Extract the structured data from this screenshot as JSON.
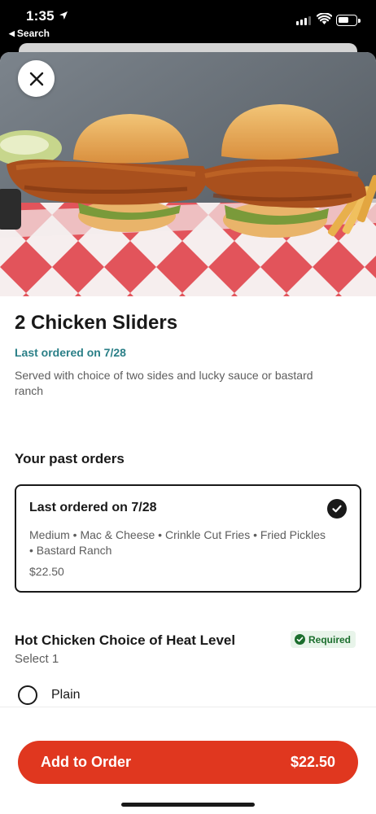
{
  "status_bar": {
    "time": "1:35",
    "back_label": "Search"
  },
  "item": {
    "name": "2 Chicken Sliders",
    "last_ordered": "Last ordered on 7/28",
    "description": "Served with choice of two sides and lucky sauce or bastard ranch"
  },
  "past_orders": {
    "heading": "Your past orders",
    "card": {
      "title": "Last ordered on 7/28",
      "items": "Medium • Mac & Cheese • Crinkle Cut Fries • Fried Pickles • Bastard Ranch",
      "price": "$22.50",
      "selected": true
    }
  },
  "option_group": {
    "title": "Hot Chicken Choice of Heat Level",
    "badge": "Required",
    "hint": "Select 1",
    "options": [
      {
        "label": "Plain",
        "selected": false
      }
    ]
  },
  "cta": {
    "label": "Add to Order",
    "price": "$22.50"
  },
  "colors": {
    "brand_red": "#e0371f",
    "accent_teal": "#2a7f87",
    "required_green": "#1b6e2d"
  },
  "icons": [
    "location-arrow-icon",
    "back-triangle-icon",
    "signal-icon",
    "wifi-icon",
    "battery-icon",
    "close-icon",
    "checkmark-icon"
  ]
}
